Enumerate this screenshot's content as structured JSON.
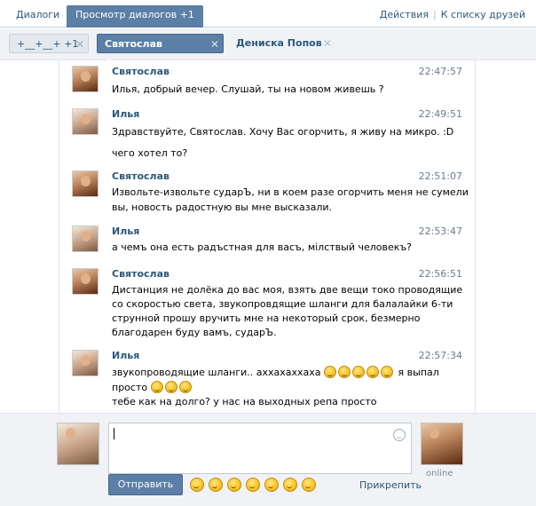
{
  "top_tabs": {
    "dialogs": "Диалоги",
    "view": "Просмотр диалогов +1"
  },
  "top_links": {
    "actions": "Действия",
    "sep": "|",
    "friends": "К списку друзей"
  },
  "chat_tabs": [
    {
      "label": "+__+__+ +1"
    },
    {
      "label": "Святослав Осипенко"
    },
    {
      "label": "Дениска Попов"
    }
  ],
  "messages": [
    {
      "author": "Святослав",
      "time": "22:47:57",
      "lines": [
        "Илья, добрый вечер. Слушай, ты на новом живешь ?"
      ]
    },
    {
      "author": "Илья",
      "time": "22:49:51",
      "lines": [
        "Здравствуйте, Святослав. Хочу Вас огорчить, я живу на микро. :D",
        "чего хотел то?"
      ]
    },
    {
      "author": "Святослав",
      "time": "22:51:07",
      "lines": [
        "Извольте-извольте сударЪ, ни в коем разе огорчить меня не сумели",
        "вы, новость радостную вы мне высказали."
      ]
    },
    {
      "author": "Илья",
      "time": "22:53:47",
      "lines": [
        "а чемъ она есть радъстная для васъ, мілствый человекъ?"
      ]
    },
    {
      "author": "Святослав",
      "time": "22:56:51",
      "lines": [
        "Дистанция не долёка до вас моя, взять две вещи токо проводящие",
        "со скоростью света, звукопровдящие шланги для балалайки 6-ти",
        "струнной прошу вручить мне на некоторый срок, безмерно",
        "благодарен буду вамъ, сударЪ."
      ]
    },
    {
      "author": "Илья",
      "time": "22:57:34",
      "lines": [
        "звукопроводящие шланги.. аххахаххаха",
        "я выпал",
        "просто",
        "тебе как на долго? у нас на выходных репа просто"
      ]
    }
  ],
  "composer": {
    "send": "Отправить",
    "attach": "Прикрепить",
    "online": "online"
  }
}
